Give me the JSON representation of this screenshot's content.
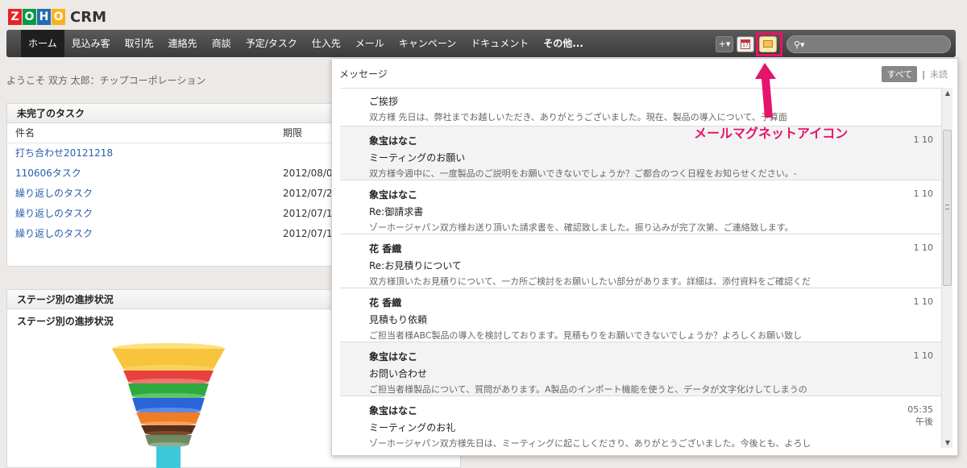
{
  "logo": {
    "letters": [
      "Z",
      "O",
      "H",
      "O"
    ],
    "product": "CRM"
  },
  "nav": [
    {
      "label": "ホーム",
      "active": true
    },
    {
      "label": "見込み客"
    },
    {
      "label": "取引先"
    },
    {
      "label": "連絡先"
    },
    {
      "label": "商談"
    },
    {
      "label": "予定/タスク"
    },
    {
      "label": "仕入先"
    },
    {
      "label": "メール"
    },
    {
      "label": "キャンペーン"
    },
    {
      "label": "ドキュメント"
    },
    {
      "label": "その他..."
    }
  ],
  "toolbar": {
    "plus_icon": "plus-icon",
    "calendar_icon": "calendar-icon",
    "calendar_day": "17",
    "mail_icon": "mail-magnet-icon",
    "search_icon": "search-icon"
  },
  "welcome": "ようこそ 双方 太郎：チップコーポレーション",
  "tasks": {
    "title": "未完了のタスク",
    "headers": [
      "件名",
      "期限"
    ],
    "rows": [
      {
        "name": "打ち合わせ20121218",
        "due": ""
      },
      {
        "name": "110606タスク",
        "due": "2012/08/0"
      },
      {
        "name": "繰り返しのタスク",
        "due": "2012/07/2"
      },
      {
        "name": "繰り返しのタスク",
        "due": "2012/07/1"
      },
      {
        "name": "繰り返しのタスク",
        "due": "2012/07/1"
      }
    ]
  },
  "stage": {
    "title": "ステージ別の進捗状況",
    "subtitle": "ステージ別の進捗状況"
  },
  "messages": {
    "title": "メッセージ",
    "filter_all": "すべて",
    "filter_sep": "|",
    "filter_unread": "未読",
    "items": [
      {
        "sender": "",
        "subject": "ご挨拶",
        "preview": "双方様 先日は、弊社までお越しいただき、ありがとうございました。現在、製品の導入について、予算面",
        "date": ""
      },
      {
        "sender": "象宝はなこ",
        "subject": "ミーティングのお願い",
        "preview": "双方様今週中に、一度製品のご説明をお願いできないでしょうか？ご都合のつく日程をお知らせください。-",
        "date": "1 10"
      },
      {
        "sender": "象宝はなこ",
        "subject": "Re:御請求書",
        "preview": "ゾーホージャパン双方様お送り頂いた請求書を、確認致しました。振り込みが完了次第、ご連絡致します。",
        "date": "1 10"
      },
      {
        "sender": "花 香織",
        "subject": "Re:お見積りについて",
        "preview": "双方様頂いたお見積りについて、一カ所ご検討をお願いしたい部分があります。詳細は、添付資料をご確認くだ",
        "date": "1 10"
      },
      {
        "sender": "花 香織",
        "subject": "見積もり依頼",
        "preview": "ご担当者様ABC製品の導入を検討しております。見積もりをお願いできないでしょうか？よろしくお願い致し",
        "date": "1 10"
      },
      {
        "sender": "象宝はなこ",
        "subject": "お問い合わせ",
        "preview": "ご担当者様製品について、質問があります。A製品のインポート機能を使うと、データが文字化けしてしまうの",
        "date": "1 10"
      },
      {
        "sender": "象宝はなこ",
        "subject": "ミーティングのお礼",
        "preview": "ゾーホージャパン双方様先日は、ミーティングに起こしくださり、ありがとうございました。今後とも、よろし",
        "date": "05:35 午後"
      }
    ]
  },
  "annotation": {
    "label": "メールマグネットアイコン",
    "color": "#e5146b"
  }
}
